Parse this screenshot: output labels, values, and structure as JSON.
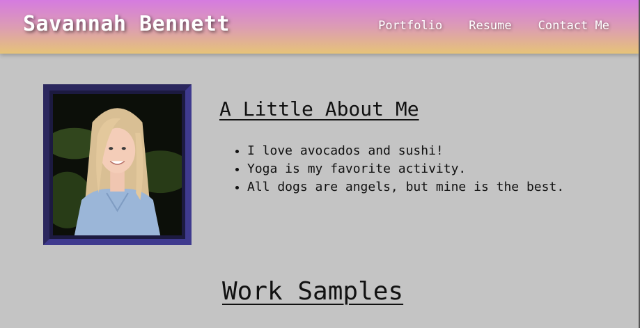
{
  "header": {
    "site_title": "Savannah Bennett",
    "nav": [
      {
        "label": "Portfolio"
      },
      {
        "label": "Resume"
      },
      {
        "label": "Contact Me"
      }
    ]
  },
  "about": {
    "heading": "A Little About Me",
    "items": [
      "I love avocados and sushi!",
      "Yoga is my favorite activity.",
      "All dogs are angels, but mine is the best."
    ]
  },
  "work": {
    "heading": "Work Samples"
  },
  "colors": {
    "background": "#c4c4c4",
    "header_gradient_top": "#d57be0",
    "header_gradient_bottom": "#e6c378",
    "photo_frame": "#2b275e"
  }
}
